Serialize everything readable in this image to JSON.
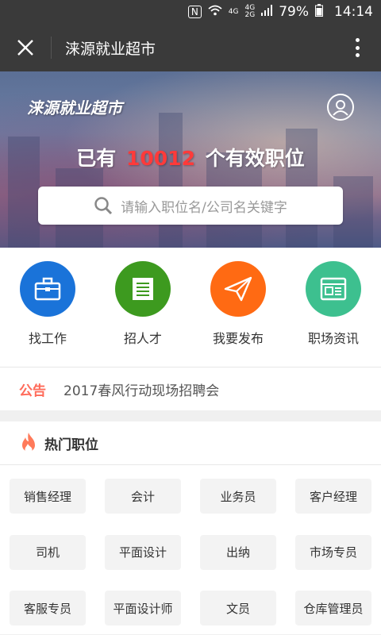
{
  "statusbar": {
    "nfc": "N",
    "net1": "4G",
    "net2": "4G",
    "net3": "2G",
    "battery": "79%",
    "time": "14:14"
  },
  "titlebar": {
    "title": "涞源就业超市"
  },
  "hero": {
    "brand": "涞源就业超市",
    "count_prefix": "已有",
    "count_value": "10012",
    "count_suffix": "个有效职位",
    "search_placeholder": "请输入职位名/公司名关键字"
  },
  "quick": [
    {
      "label": "找工作",
      "color": "#1a73d9",
      "icon": "briefcase-icon"
    },
    {
      "label": "招人才",
      "color": "#3d9a1f",
      "icon": "list-icon"
    },
    {
      "label": "我要发布",
      "color": "#ff6a13",
      "icon": "paper-plane-icon"
    },
    {
      "label": "职场资讯",
      "color": "#3dc08f",
      "icon": "news-icon"
    }
  ],
  "notice": {
    "tag": "公告",
    "text": "2017春风行动现场招聘会"
  },
  "hot": {
    "title": "热门职位",
    "jobs": [
      "销售经理",
      "会计",
      "业务员",
      "客户经理",
      "司机",
      "平面设计",
      "出纳",
      "市场专员",
      "客服专员",
      "平面设计师",
      "文员",
      "仓库管理员"
    ]
  }
}
